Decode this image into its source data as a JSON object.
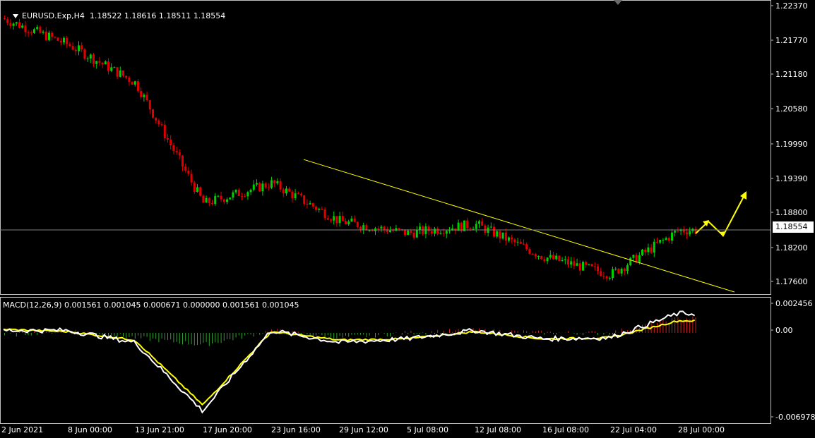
{
  "header": {
    "symbol_timeframe": "EURUSD.Exp,H4",
    "ohlc": "1.18522 1.18616 1.18511 1.18554"
  },
  "macd_header": "MACD(12,26,9) 0.001561 0.001045 0.000671 0.000000 0.001561 0.001045",
  "price_axis": [
    "1.22370",
    "1.21770",
    "1.21180",
    "1.20580",
    "1.19990",
    "1.19390",
    "1.18800",
    "1.18200",
    "1.17600"
  ],
  "current_price": "1.18554",
  "macd_axis": [
    "0.002456",
    "0.00",
    "-0.006978"
  ],
  "date_axis": [
    "2 Jun 2021",
    "8 Jun 00:00",
    "13 Jun 21:00",
    "17 Jun 20:00",
    "23 Jun 16:00",
    "29 Jun 12:00",
    "5 Jul 08:00",
    "12 Jul 08:00",
    "16 Jul 08:00",
    "22 Jul 04:00",
    "28 Jul 00:00"
  ],
  "colors": {
    "background": "#000000",
    "bull_candle": "#00d000",
    "bear_candle": "#e00000",
    "trendline": "#ffff00",
    "forecast_arrows": "#ffff00",
    "macd_line": "#ffffff",
    "signal_line": "#ffff00",
    "hist_positive": "#d02020",
    "hist_negative": "#30a030",
    "grid_frame": "#c0c0c0"
  },
  "chart_data": [
    {
      "type": "candlestick",
      "x": [
        "2 Jun 2021",
        "8 Jun 00:00",
        "13 Jun 21:00",
        "17 Jun 20:00",
        "23 Jun 16:00",
        "29 Jun 12:00",
        "5 Jul 08:00",
        "12 Jul 08:00",
        "16 Jul 08:00",
        "22 Jul 04:00",
        "28 Jul 00:00"
      ],
      "close": [
        1.2215,
        1.217,
        1.2105,
        1.19,
        1.1935,
        1.187,
        1.185,
        1.1865,
        1.181,
        1.178,
        1.1855
      ],
      "ylim": [
        1.175,
        1.224
      ],
      "last_price": 1.18554,
      "trendline": {
        "from": [
          "23 Jun 16:00",
          1.1975
        ],
        "to": [
          "28 Jul 00:00",
          1.175
        ]
      }
    },
    {
      "type": "line",
      "title": "MACD(12,26,9)",
      "x": [
        "2 Jun 2021",
        "8 Jun 00:00",
        "13 Jun 21:00",
        "17 Jun 20:00",
        "23 Jun 16:00",
        "29 Jun 12:00",
        "5 Jul 08:00",
        "12 Jul 08:00",
        "16 Jul 08:00",
        "22 Jul 04:00",
        "28 Jul 00:00"
      ],
      "series": [
        {
          "values": [
            0.0002,
            0.0002,
            -0.0008,
            -0.0065,
            0.0002,
            -0.0008,
            -0.0005,
            0.0002,
            -0.0005,
            -0.0004,
            0.0016
          ]
        },
        {
          "values": [
            0.0003,
            0.0001,
            -0.0006,
            -0.006,
            0.0001,
            -0.0006,
            -0.0005,
            0.0001,
            -0.0005,
            -0.0004,
            0.001
          ]
        }
      ],
      "ylim": [
        -0.006978,
        0.002456
      ]
    }
  ]
}
